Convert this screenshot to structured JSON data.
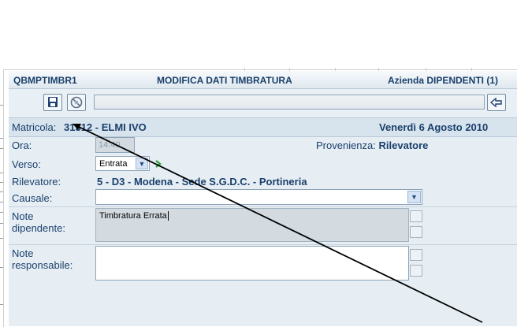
{
  "header": {
    "program_code": "QBMPTIMBR1",
    "title": "MODIFICA DATI TIMBRATURA",
    "company": "Azienda DIPENDENTI (1)"
  },
  "toolbar": {
    "save_icon": "floppy-disk-icon",
    "cancel_icon": "cancel-circle-icon",
    "back_icon": "back-arrow-icon"
  },
  "record": {
    "matricola_label": "Matricola:",
    "matricola_value": "31312 - ELMI IVO",
    "date": "Venerdì 6 Agosto 2010"
  },
  "form": {
    "ora_label": "Ora:",
    "ora_value": "14:40",
    "provenienza_label": "Provenienza:",
    "provenienza_value": "Rilevatore",
    "verso_label": "Verso:",
    "verso_value": "Entrata",
    "rilevatore_label": "Rilevatore:",
    "rilevatore_value": "5 - D3 - Modena - Sede S.G.D.C. - Portineria",
    "causale_label": "Causale:",
    "causale_value": "",
    "note_dip_label_1": "Note",
    "note_dip_label_2": "dipendente:",
    "note_dip_value": "Timbratura Errata",
    "note_resp_label_1": "Note",
    "note_resp_label_2": "responsabile:",
    "note_resp_value": ""
  },
  "colors": {
    "panel": "#e6eef4",
    "text": "#1a3f6b",
    "next_arrow": "#2aa33a"
  }
}
